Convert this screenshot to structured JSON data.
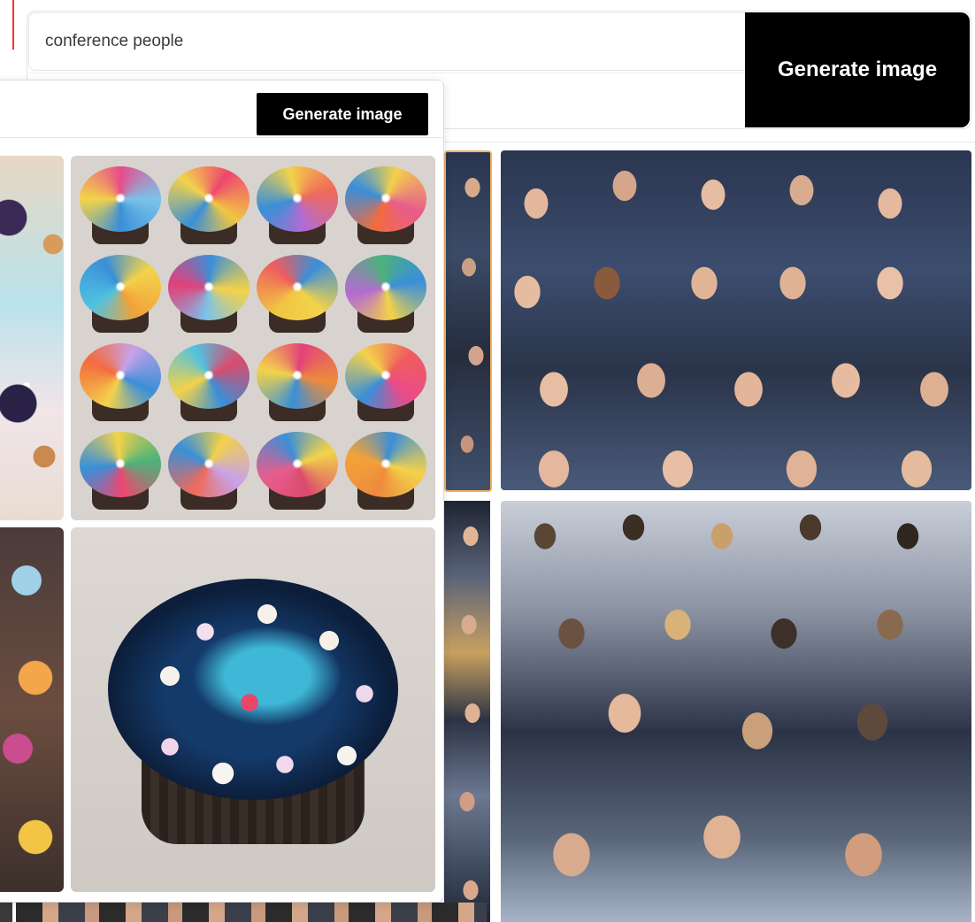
{
  "back_window": {
    "search": {
      "value": "conference people",
      "placeholder": ""
    },
    "generate_label": "Generate image",
    "images": [
      {
        "name": "crowd-portraits-strip"
      },
      {
        "name": "conference-crowd-facing-camera"
      },
      {
        "name": "portraits-strip-lower"
      },
      {
        "name": "conference-audience-from-behind"
      }
    ]
  },
  "front_window": {
    "search": {
      "value": "",
      "placeholder": ""
    },
    "generate_label": "Generate image",
    "images": [
      {
        "name": "galaxy-cupcake-partial-1"
      },
      {
        "name": "galaxy-cupcakes-grid"
      },
      {
        "name": "rainbow-cupcakes-partial"
      },
      {
        "name": "galaxy-cupcake-closeup"
      }
    ],
    "cupcake_colors": [
      "#e94b8a",
      "#ef4670",
      "#ef6a5a",
      "#e75d8d",
      "#f2a23a",
      "#7bc2ea",
      "#f0c642",
      "#b46bd1",
      "#f36b3f",
      "#4fc2e0",
      "#e2417a",
      "#ef5d5d",
      "#4db27a",
      "#c7a2e8",
      "#d94b6d",
      "#ee8a3c"
    ]
  },
  "colors": {
    "accent_button": "#000000",
    "panel_border": "#dcdcdc",
    "selected_outline": "#f0b060"
  }
}
